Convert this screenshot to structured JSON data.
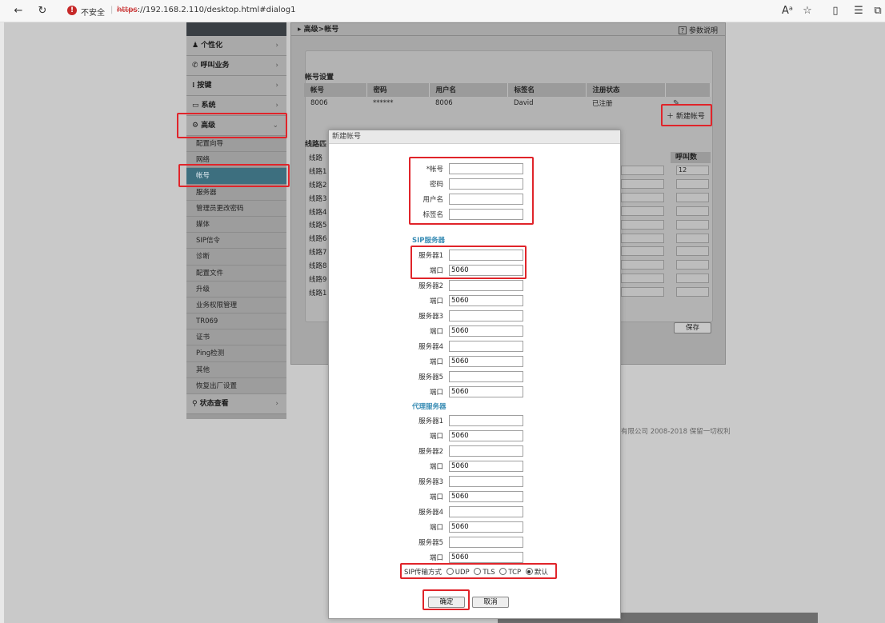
{
  "browser": {
    "security_label": "不安全",
    "url_protocol": "https",
    "url_rest": "://192.168.2.110/desktop.html#dialog1",
    "reader_icon": "A⁾",
    "back_icon": "back-arrow-icon",
    "reload_icon": "reload-icon"
  },
  "sidebar": {
    "categories": [
      {
        "label": "个性化",
        "icon": "person-icon"
      },
      {
        "label": "呼叫业务",
        "icon": "phone-icon"
      },
      {
        "label": "按键",
        "icon": "keypad-icon"
      },
      {
        "label": "系统",
        "icon": "monitor-icon"
      },
      {
        "label": "高级",
        "icon": "gear-icon"
      }
    ],
    "sub_items": [
      "配置向导",
      "网络",
      "帐号",
      "服务器",
      "管理员更改密码",
      "媒体",
      "SIP信令",
      "诊断",
      "配置文件",
      "升级",
      "业务权限管理",
      "TR069",
      "证书",
      "Ping检测",
      "其他",
      "恢复出厂设置"
    ],
    "active_sub": "帐号",
    "status": {
      "label": "状态查看",
      "icon": "search-icon"
    }
  },
  "main": {
    "breadcrumb": "高级>帐号",
    "help": "参数说明",
    "section_title": "帐号设置",
    "table": {
      "headers": [
        "帐号",
        "密码",
        "用户名",
        "标签名",
        "注册状态"
      ],
      "rows": [
        [
          "8006",
          "******",
          "8006",
          "David",
          "已注册"
        ]
      ]
    },
    "new_account": "新建帐号",
    "line_title": "线路匹",
    "lines": [
      "线路",
      "线路1",
      "线路2",
      "线路3",
      "线路4",
      "线路5",
      "线路6",
      "线路7",
      "线路8",
      "线路9",
      "线路1"
    ],
    "calls_header": "呼叫数",
    "calls_value": "12",
    "save": "保存",
    "copyright": "有限公司 2008-2018 保留一切权利"
  },
  "dialog": {
    "title": "新建帐号",
    "account_fields": [
      {
        "label": "*帐号",
        "value": ""
      },
      {
        "label": "密码",
        "value": ""
      },
      {
        "label": "用户名",
        "value": ""
      },
      {
        "label": "标签名",
        "value": ""
      }
    ],
    "sip_heading": "SIP服务器",
    "sip_fields": [
      {
        "label": "服务器1",
        "value": ""
      },
      {
        "label": "端口",
        "value": "5060"
      },
      {
        "label": "服务器2",
        "value": ""
      },
      {
        "label": "端口",
        "value": "5060"
      },
      {
        "label": "服务器3",
        "value": ""
      },
      {
        "label": "端口",
        "value": "5060"
      },
      {
        "label": "服务器4",
        "value": ""
      },
      {
        "label": "端口",
        "value": "5060"
      },
      {
        "label": "服务器5",
        "value": ""
      },
      {
        "label": "端口",
        "value": "5060"
      }
    ],
    "proxy_heading": "代理服务器",
    "proxy_fields": [
      {
        "label": "服务器1",
        "value": ""
      },
      {
        "label": "端口",
        "value": "5060"
      },
      {
        "label": "服务器2",
        "value": ""
      },
      {
        "label": "端口",
        "value": "5060"
      },
      {
        "label": "服务器3",
        "value": ""
      },
      {
        "label": "端口",
        "value": "5060"
      },
      {
        "label": "服务器4",
        "value": ""
      },
      {
        "label": "端口",
        "value": "5060"
      },
      {
        "label": "服务器5",
        "value": ""
      },
      {
        "label": "端口",
        "value": "5060"
      }
    ],
    "transport_label": "SIP传输方式",
    "transport_options": [
      "UDP",
      "TLS",
      "TCP",
      "默认"
    ],
    "transport_selected": "默认",
    "ok": "确定",
    "cancel": "取消"
  },
  "colors": {
    "highlight": "#e0242a",
    "accent": "#3a8db5",
    "active_nav": "#3d6f7f"
  }
}
